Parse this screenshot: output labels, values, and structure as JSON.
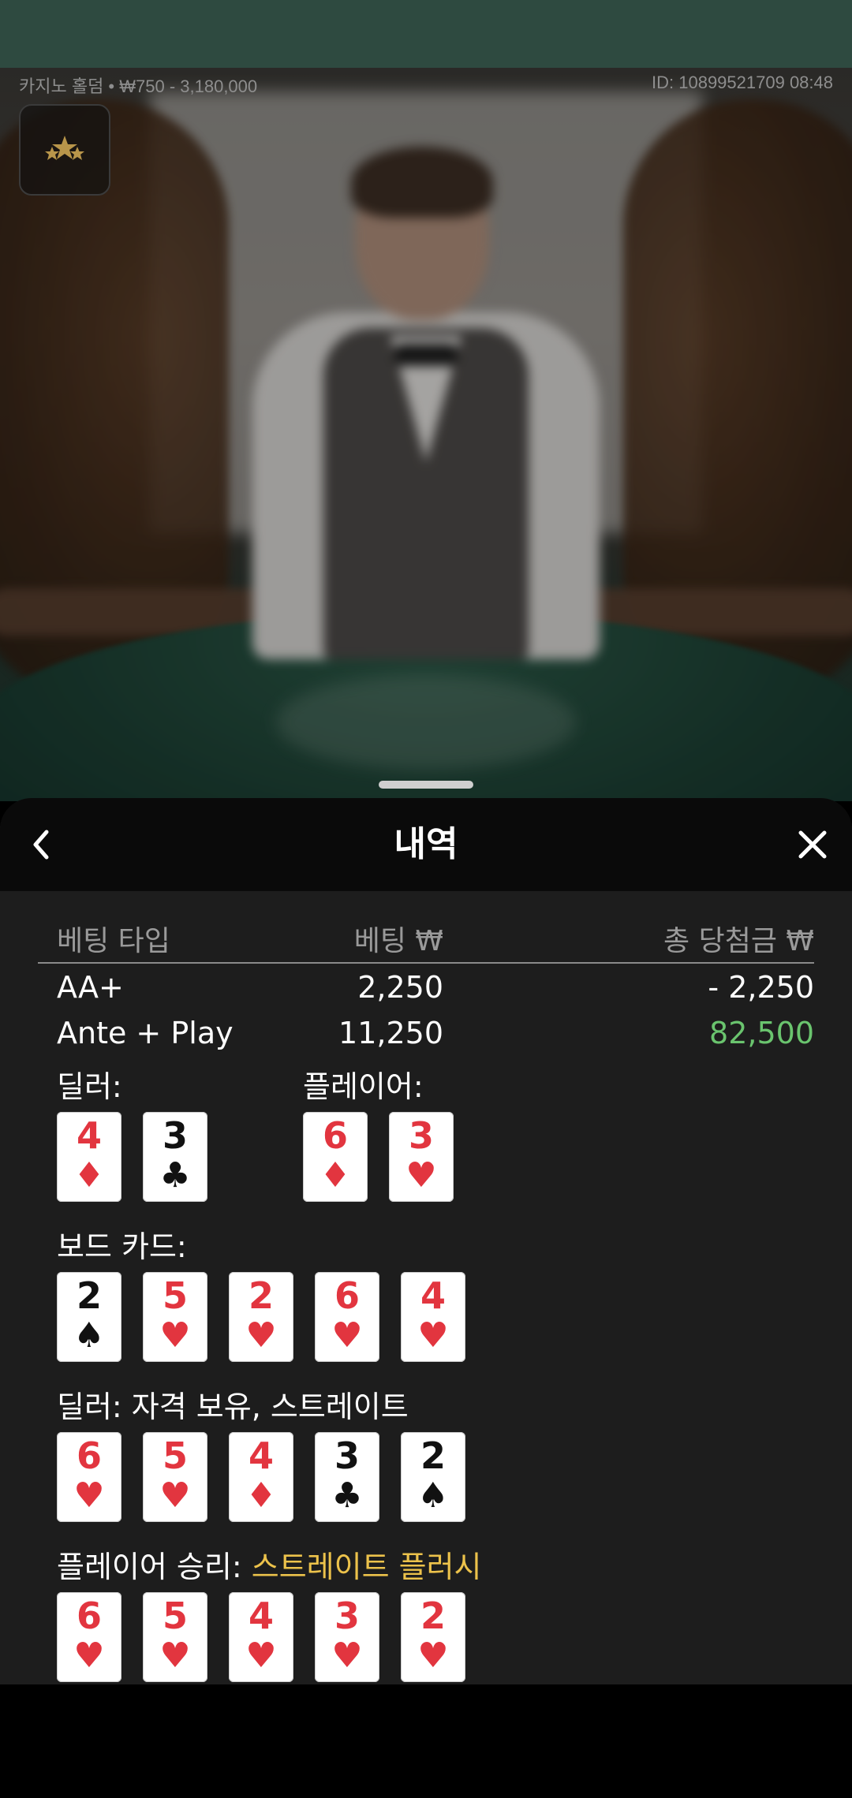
{
  "game_info": {
    "table_name": "카지노 홀덤 • ₩750 - 3,180,000",
    "round_id": "ID: 10899521709 08:48"
  },
  "panel": {
    "title": "내역",
    "back_icon": "chevron-left-icon",
    "close_icon": "close-icon"
  },
  "bets": {
    "headers": {
      "type": "베팅 타입",
      "bet": "베팅 ₩",
      "win": "총 당첨금 ₩"
    },
    "rows": [
      {
        "type": "AA+",
        "bet": "2,250",
        "win": "- 2,250",
        "win_color": "#ffffff"
      },
      {
        "type": "Ante + Play",
        "bet": "11,250",
        "win": "82,500",
        "win_color": "#6ac46e"
      }
    ]
  },
  "dealer_hand": {
    "label": "딜러:",
    "cards": [
      {
        "rank": "4",
        "suit": "♦",
        "color": "red"
      },
      {
        "rank": "3",
        "suit": "♣",
        "color": "black"
      }
    ]
  },
  "player_hand": {
    "label": "플레이어:",
    "cards": [
      {
        "rank": "6",
        "suit": "♦",
        "color": "red"
      },
      {
        "rank": "3",
        "suit": "♥",
        "color": "red"
      }
    ]
  },
  "board": {
    "label": "보드 카드:",
    "cards": [
      {
        "rank": "2",
        "suit": "♠",
        "color": "black"
      },
      {
        "rank": "5",
        "suit": "♥",
        "color": "red"
      },
      {
        "rank": "2",
        "suit": "♥",
        "color": "red"
      },
      {
        "rank": "6",
        "suit": "♥",
        "color": "red"
      },
      {
        "rank": "4",
        "suit": "♥",
        "color": "red"
      }
    ]
  },
  "dealer_result": {
    "label": "딜러: 자격 보유, 스트레이트",
    "cards": [
      {
        "rank": "6",
        "suit": "♥",
        "color": "red"
      },
      {
        "rank": "5",
        "suit": "♥",
        "color": "red"
      },
      {
        "rank": "4",
        "suit": "♦",
        "color": "red"
      },
      {
        "rank": "3",
        "suit": "♣",
        "color": "black"
      },
      {
        "rank": "2",
        "suit": "♠",
        "color": "black"
      }
    ]
  },
  "player_result": {
    "label_prefix": "플레이어 승리: ",
    "label_highlight": "스트레이트 플러시",
    "highlight_color": "#ecc24b",
    "cards": [
      {
        "rank": "6",
        "suit": "♥",
        "color": "red"
      },
      {
        "rank": "5",
        "suit": "♥",
        "color": "red"
      },
      {
        "rank": "4",
        "suit": "♥",
        "color": "red"
      },
      {
        "rank": "3",
        "suit": "♥",
        "color": "red"
      },
      {
        "rank": "2",
        "suit": "♥",
        "color": "red"
      }
    ]
  },
  "colors": {
    "status_bar": "#2e4a40",
    "panel_bg": "#1d1d1d",
    "header_bg": "#0a0a0a",
    "card_red": "#e2353f",
    "win_green": "#6ac46e"
  }
}
